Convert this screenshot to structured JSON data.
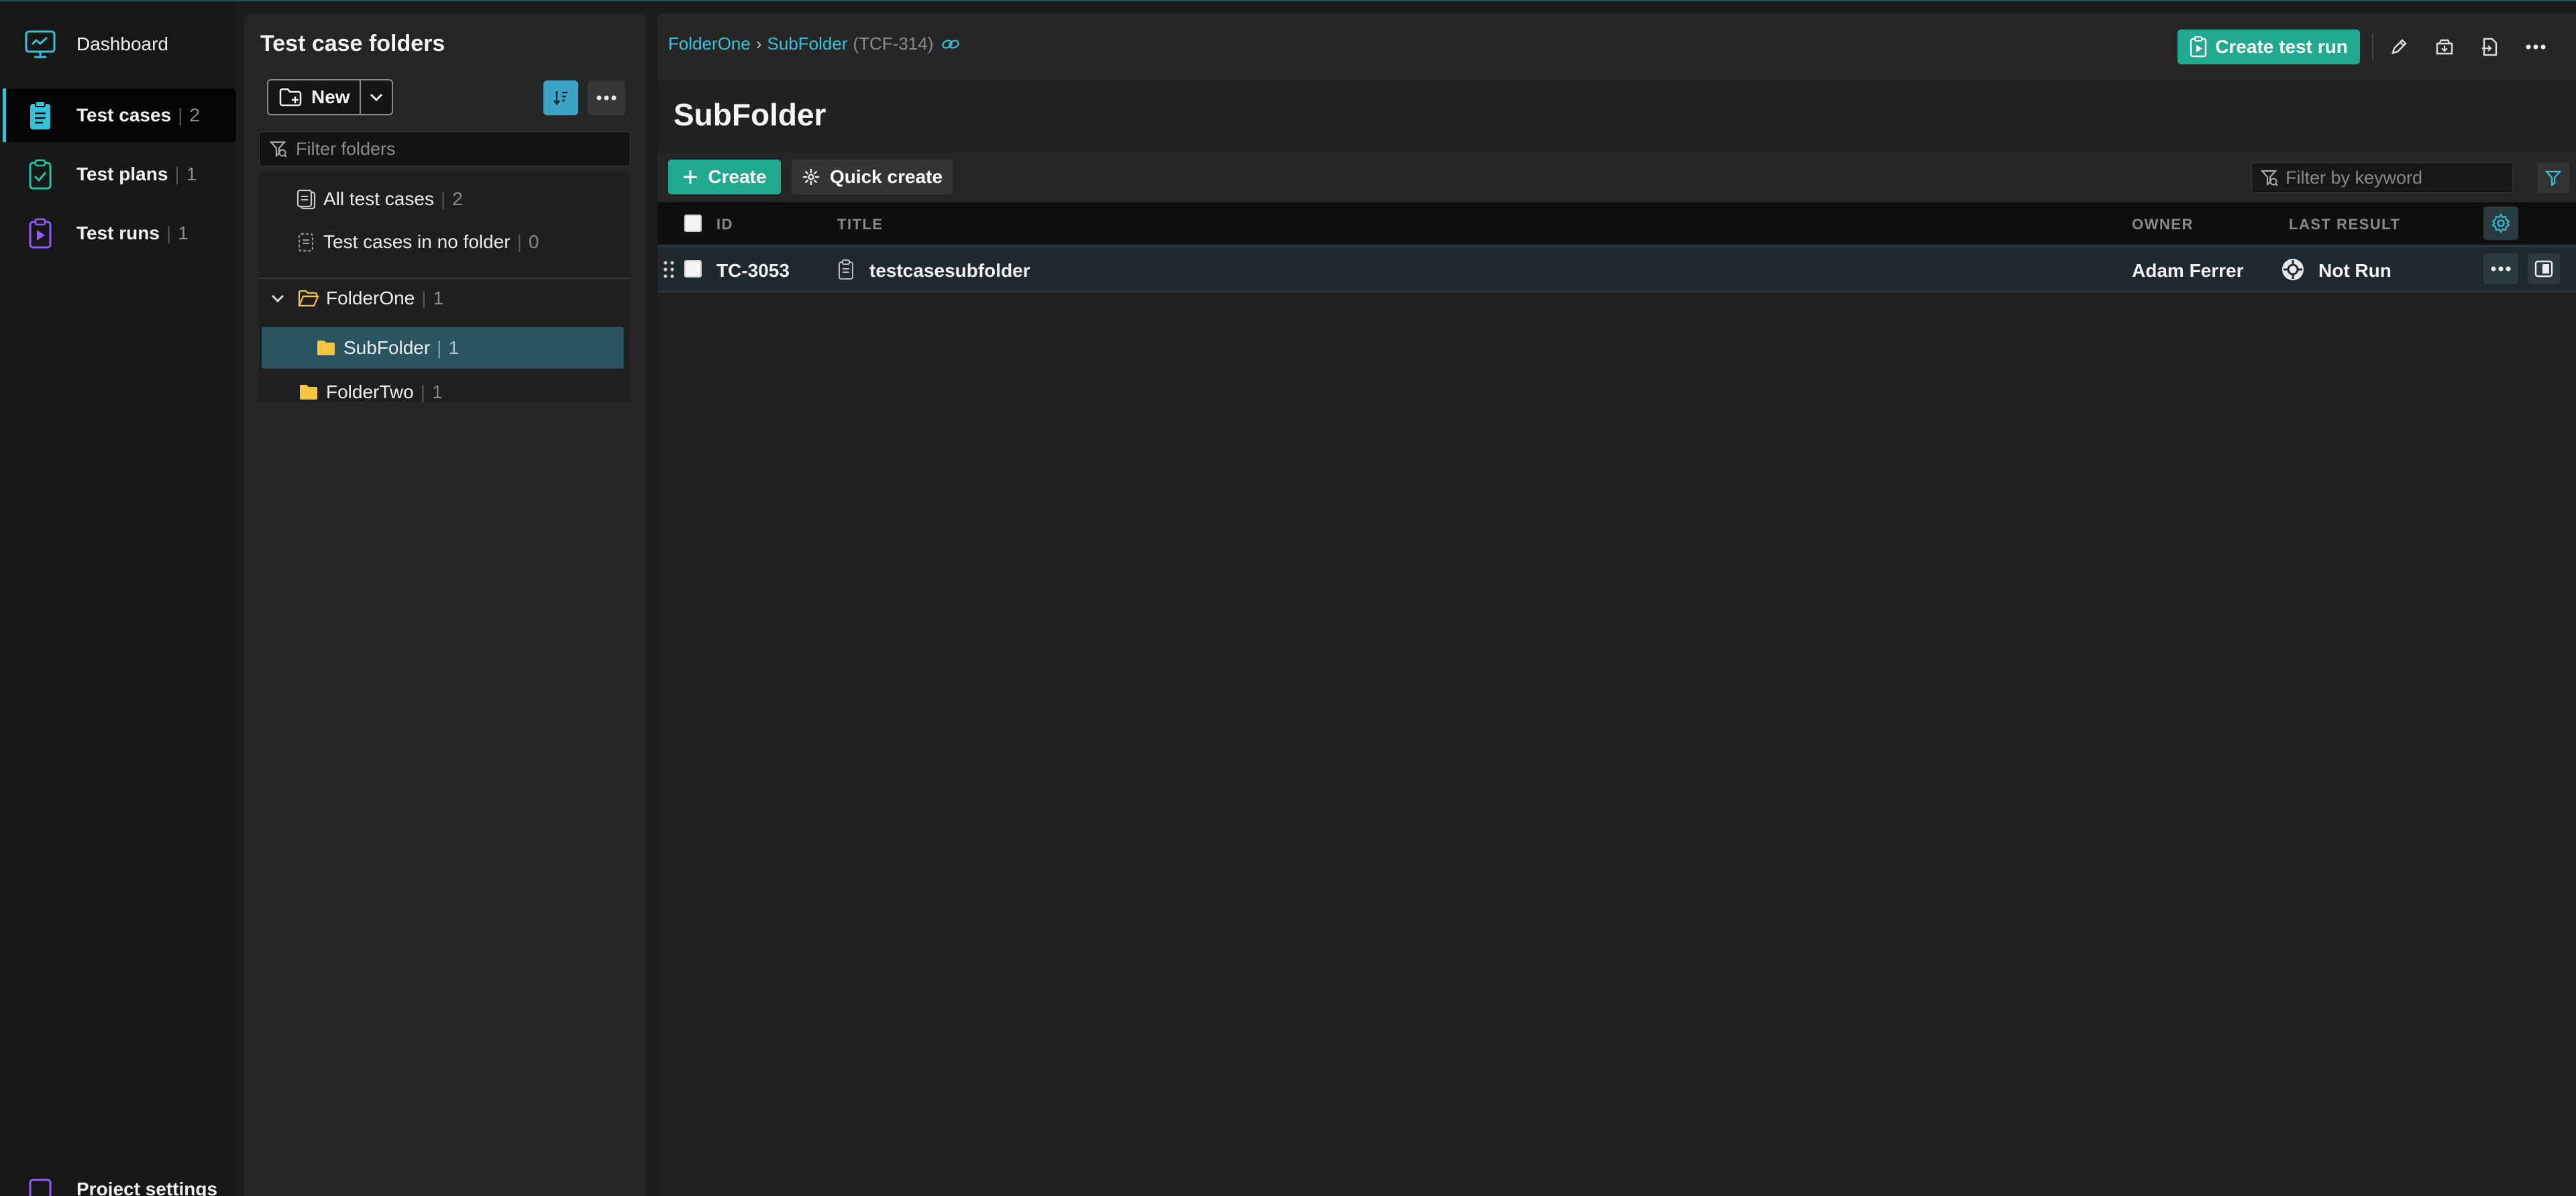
{
  "nav": {
    "dashboard": "Dashboard",
    "items": [
      {
        "label": "Test cases",
        "count": "2"
      },
      {
        "label": "Test plans",
        "count": "1"
      },
      {
        "label": "Test runs",
        "count": "1"
      }
    ],
    "bottom_label": "Project settings"
  },
  "folders_panel": {
    "title": "Test case folders",
    "new_label": "New",
    "filter_placeholder": "Filter folders",
    "all_label": "All test cases",
    "all_count": "2",
    "nofolder_label": "Test cases in no folder",
    "nofolder_count": "0",
    "tree": [
      {
        "label": "FolderOne",
        "count": "1"
      },
      {
        "label": "SubFolder",
        "count": "1"
      },
      {
        "label": "FolderTwo",
        "count": "1"
      }
    ]
  },
  "main": {
    "breadcrumb": {
      "parent": "FolderOne",
      "separator": "›",
      "current": "SubFolder",
      "key": "(TCF-314)"
    },
    "create_run_label": "Create test run",
    "title": "SubFolder",
    "create_label": "Create",
    "quick_create_label": "Quick create",
    "keyword_placeholder": "Filter by keyword",
    "columns": {
      "id": "ID",
      "title": "TITLE",
      "owner": "OWNER",
      "last_result": "LAST RESULT"
    },
    "rows": [
      {
        "id": "TC-3053",
        "title": "testcasesubfolder",
        "owner": "Adam Ferrer",
        "last_result": "Not Run"
      }
    ]
  },
  "colors": {
    "accent": "#35c3d8",
    "primary_button": "#1fa98f",
    "folder": "#f5c542",
    "test_runs_icon": "#8b5cf6"
  }
}
